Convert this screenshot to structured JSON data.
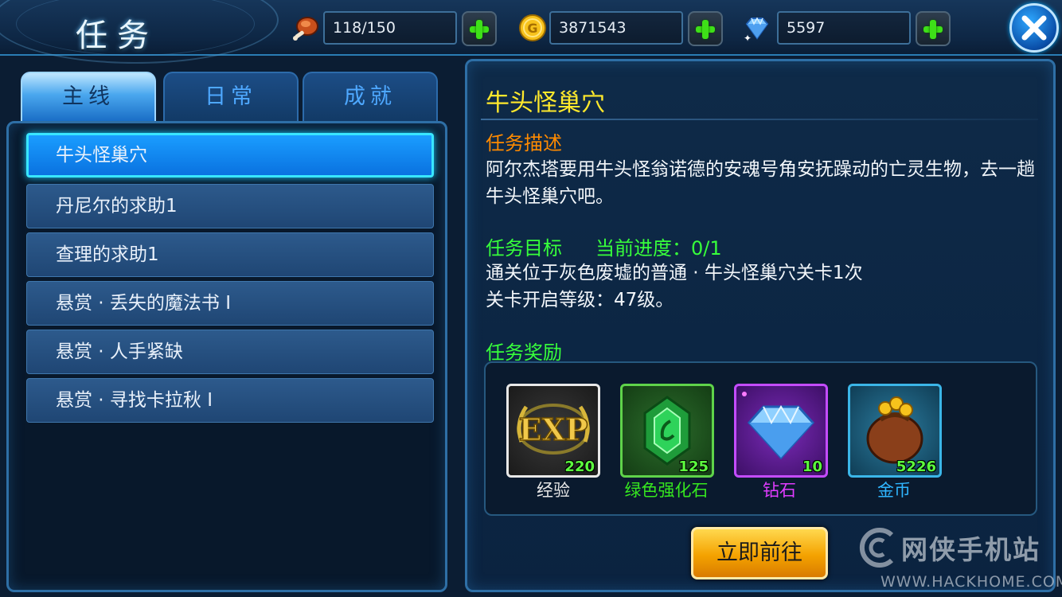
{
  "header": {
    "title": "任务",
    "stamina": {
      "icon": "meat-icon",
      "value": "118/150"
    },
    "gold": {
      "icon": "gold-coin-icon",
      "value": "3871543"
    },
    "diamond": {
      "icon": "diamond-icon",
      "value": "5597"
    },
    "close_icon": "close-icon"
  },
  "tabs": [
    {
      "label": "主线",
      "active": true
    },
    {
      "label": "日常",
      "active": false
    },
    {
      "label": "成就",
      "active": false
    }
  ],
  "quests": [
    {
      "label": "牛头怪巢穴",
      "selected": true
    },
    {
      "label": "丹尼尔的求助1"
    },
    {
      "label": "查理的求助1"
    },
    {
      "label": "悬赏 · 丢失的魔法书 I"
    },
    {
      "label": "悬赏 · 人手紧缺"
    },
    {
      "label": "悬赏 · 寻找卡拉秋 I"
    }
  ],
  "detail": {
    "title": "牛头怪巢穴",
    "desc_heading": "任务描述",
    "desc_text": "阿尔杰塔要用牛头怪翁诺德的安魂号角安抚躁动的亡灵生物，去一趟牛头怪巢穴吧。",
    "goal_heading": "任务目标",
    "progress_label": "当前进度：0/1",
    "goal_text_1": "通关位于灰色废墟的普通 · 牛头怪巢穴关卡1次",
    "goal_text_2": "关卡开启等级：47级。",
    "reward_heading": "任务奖励",
    "rewards": [
      {
        "icon": "exp-icon",
        "badge": "EXP",
        "count": "220",
        "label": "经验",
        "label_color": "#e8e8e8"
      },
      {
        "icon": "green-gem-icon",
        "count": "125",
        "label": "绿色强化石",
        "label_color": "#36e81f"
      },
      {
        "icon": "diamond-icon",
        "count": "10",
        "label": "钻石",
        "label_color": "#e03cff"
      },
      {
        "icon": "gold-bag-icon",
        "count": "5226",
        "label": "金币",
        "label_color": "#2fb6ff"
      }
    ],
    "go_button": "立即前往"
  },
  "watermark": {
    "text": "网侠手机站",
    "url": "WWW.HACKHOME.COM"
  },
  "colors": {
    "accent_yellow": "#ffe92c",
    "section_orange": "#ff8a00",
    "section_green": "#37ff3b",
    "selected_blue": "#1a9dff"
  }
}
